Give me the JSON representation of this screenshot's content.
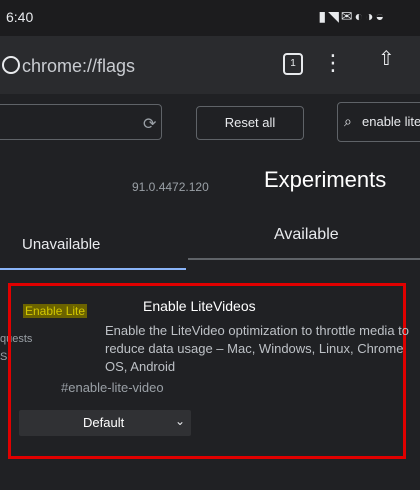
{
  "status_bar": {
    "time": "6:40",
    "icons_text": "▮◥✉◐◑◒"
  },
  "url_bar": {
    "url": "chrome://flags",
    "tab_count": "1"
  },
  "toolbar": {
    "reset_label": "Reset all",
    "search_value": "enable lite"
  },
  "header": {
    "version": "91.0.4472.120",
    "title": "Experiments"
  },
  "tabs": [
    {
      "label": "Unavailable"
    },
    {
      "label": "Available"
    }
  ],
  "side_fragment": {
    "line1": "quests",
    "line2": "S."
  },
  "experiment": {
    "match_highlight": "Enable Lite",
    "title": "Enable LiteVideos",
    "description": "Enable the LiteVideo optimization to throttle media to reduce data usage – Mac, Windows, Linux, Chrome OS, Android",
    "link": "#enable-lite-video",
    "select_value": "Default"
  },
  "colors": {
    "accent": "#8ab4f8",
    "annotation_box": "#e00000",
    "highlight_bg": "#6b6300"
  }
}
